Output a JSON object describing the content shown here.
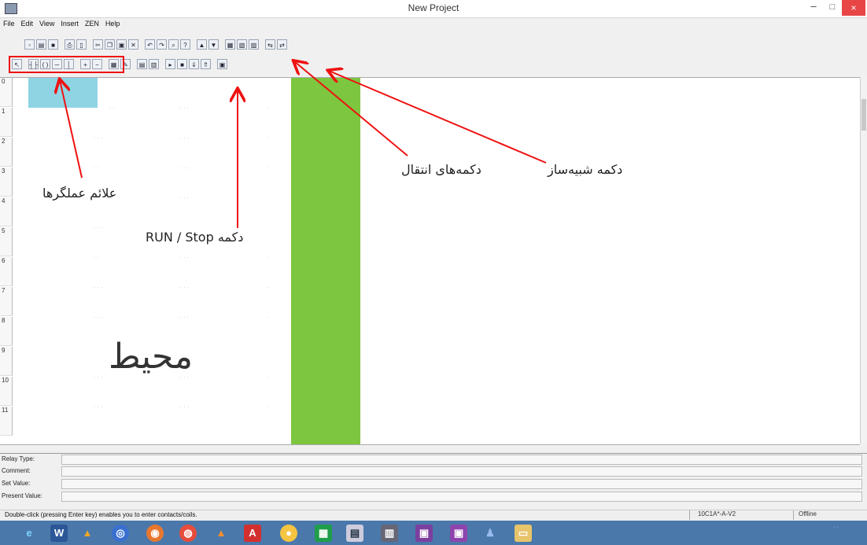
{
  "window": {
    "title": "New Project",
    "min": "–",
    "max": "□",
    "close": "×"
  },
  "menu": [
    "File",
    "Edit",
    "View",
    "Insert",
    "ZEN",
    "Help"
  ],
  "ladder": {
    "row_numbers": [
      "0",
      "1",
      "2",
      "3",
      "4",
      "5",
      "6",
      "7",
      "8",
      "9",
      "10",
      "11"
    ]
  },
  "panel": {
    "relay_type_label": "Relay Type:",
    "comment_label": "Comment:",
    "set_value_label": "Set Value:",
    "present_value_label": "Present Value:"
  },
  "status": {
    "hint": "Double-click (pressing Enter key) enables you to enter contacts/coils.",
    "model": "10C1A*-A-V2",
    "connection": "Offline"
  },
  "annotations": {
    "operators": "علائم عملگرها",
    "run_stop": "دکمه RUN / Stop",
    "transfer": "دکمه‌های انتقال",
    "simulator": "دکمه شبیه‌ساز",
    "environment": "محیط"
  },
  "colors": {
    "accent_red": "#e11",
    "cursor_cell": "#8fd4e3",
    "green_column": "#7dc63f",
    "taskbar": "#4a78aa",
    "close_button": "#e84646"
  }
}
